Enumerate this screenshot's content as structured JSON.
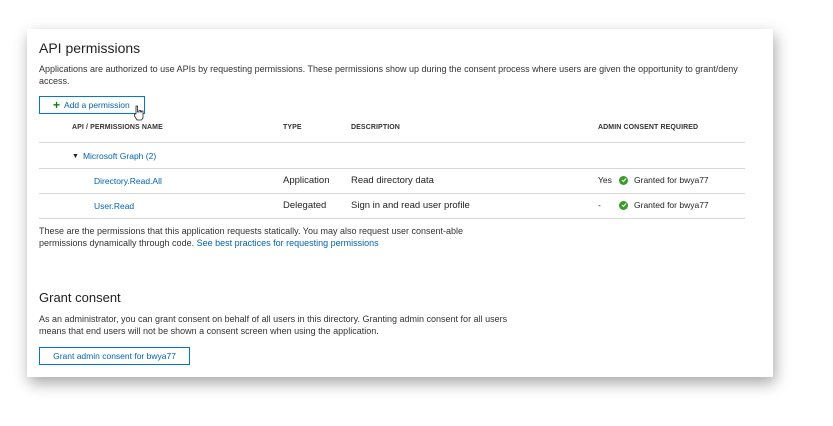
{
  "section": {
    "title": "API permissions",
    "description": "Applications are authorized to use APIs by requesting permissions. These permissions show up during the consent process where users are given the opportunity to grant/deny access."
  },
  "add_button": {
    "label": "Add a permission"
  },
  "table": {
    "headers": [
      "API / PERMISSIONS NAME",
      "TYPE",
      "DESCRIPTION",
      "ADMIN CONSENT REQUIRED"
    ],
    "group": "Microsoft Graph (2)",
    "rows": [
      {
        "name": "Directory.Read.All",
        "type": "Application",
        "description": "Read directory data",
        "admin": "Yes",
        "status": "Granted for bwya77"
      },
      {
        "name": "User.Read",
        "type": "Delegated",
        "description": "Sign in and read user profile",
        "admin": "-",
        "status": "Granted for bwya77"
      }
    ]
  },
  "note": {
    "text": "These are the permissions that this application requests statically. You may also request user consent-able permissions dynamically through code.",
    "link": "See best practices for requesting permissions"
  },
  "grant": {
    "title": "Grant consent",
    "description": "As an administrator, you can grant consent on behalf of all users in this directory. Granting admin consent for all users means that end users will not be shown a consent screen when using the application.",
    "button": "Grant admin consent for bwya77"
  },
  "colors": {
    "accent": "#0078d4",
    "link": "#0063b1",
    "success": "#3a9c27",
    "plus": "#107c10"
  }
}
